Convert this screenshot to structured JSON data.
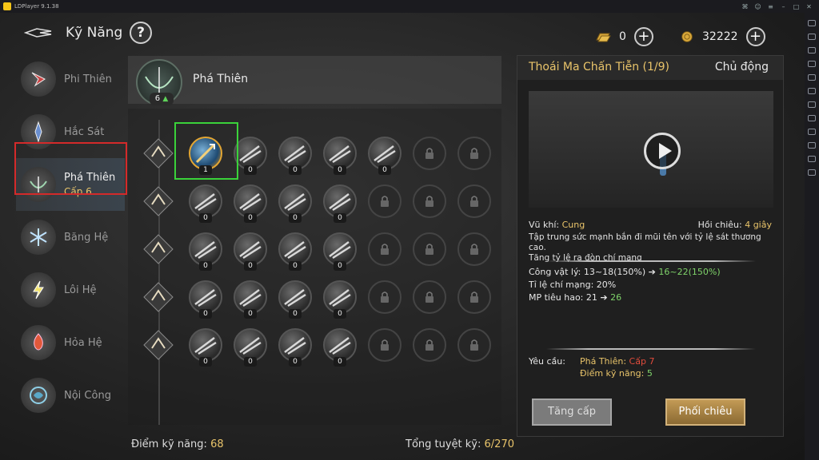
{
  "emulator": {
    "title": "LDPlayer 9.1.38"
  },
  "header": {
    "title": "Kỹ Năng",
    "help_label": "?",
    "gems": "0",
    "gold": "32222",
    "plus_label": "+"
  },
  "categories": [
    {
      "name": "Phi Thiên",
      "level": ""
    },
    {
      "name": "Hắc Sát",
      "level": ""
    },
    {
      "name": "Phá Thiên",
      "level": "Cấp 6"
    },
    {
      "name": "Băng Hệ",
      "level": ""
    },
    {
      "name": "Lôi Hệ",
      "level": ""
    },
    {
      "name": "Hỏa Hệ",
      "level": ""
    },
    {
      "name": "Nội Công",
      "level": ""
    }
  ],
  "tree": {
    "title": "Phá Thiên",
    "level": "6",
    "rows": [
      {
        "nodes": [
          "1",
          "0",
          "0",
          "0",
          "0",
          "lock",
          "lock"
        ]
      },
      {
        "nodes": [
          "0",
          "0",
          "0",
          "0",
          "lock",
          "lock",
          "lock"
        ]
      },
      {
        "nodes": [
          "0",
          "0",
          "0",
          "0",
          "lock",
          "lock",
          "lock"
        ]
      },
      {
        "nodes": [
          "0",
          "0",
          "0",
          "0",
          "lock",
          "lock",
          "lock"
        ]
      },
      {
        "nodes": [
          "0",
          "0",
          "0",
          "0",
          "lock",
          "lock",
          "lock"
        ]
      }
    ]
  },
  "footer": {
    "points_label": "Điểm kỹ năng:",
    "points_value": "68",
    "total_label": "Tổng tuyệt kỹ:",
    "total_value": "6/270"
  },
  "detail": {
    "skill_name": "Thoái Ma Chấn Tiễn (1/9)",
    "skill_type": "Chủ động",
    "weapon_label": "Vũ khí:",
    "weapon_value": "Cung",
    "cooldown_label": "Hồi chiêu:",
    "cooldown_value": "4 giây",
    "description_1": "Tập trung sức mạnh bắn đi mũi tên với tỷ lệ sát thương cao.",
    "description_2": "Tăng tỷ lệ ra đòn chí mạng",
    "attack_label": "Công vật lý:",
    "attack_value": "13~18(150%)",
    "attack_arrow": "➔",
    "attack_next": "16~22(150%)",
    "crit_label": "Tỉ lệ chí mạng:",
    "crit_value": "20%",
    "mp_label": "MP tiêu hao:",
    "mp_value": "21",
    "mp_arrow": "➔",
    "mp_next": "26",
    "req_label": "Yêu cầu:",
    "req_1_label": "Phá Thiên:",
    "req_1_value": "Cấp 7",
    "req_2_label": "Điểm kỹ năng:",
    "req_2_value": "5",
    "upgrade_button": "Tăng cấp",
    "combo_button": "Phối chiêu"
  },
  "colors": {
    "accent_gold": "#e9c46a",
    "increase_green": "#7fd36a",
    "requirement_red": "#e24c3c",
    "selection_green": "#3ad23a",
    "active_frame_red": "#d42a2a"
  }
}
